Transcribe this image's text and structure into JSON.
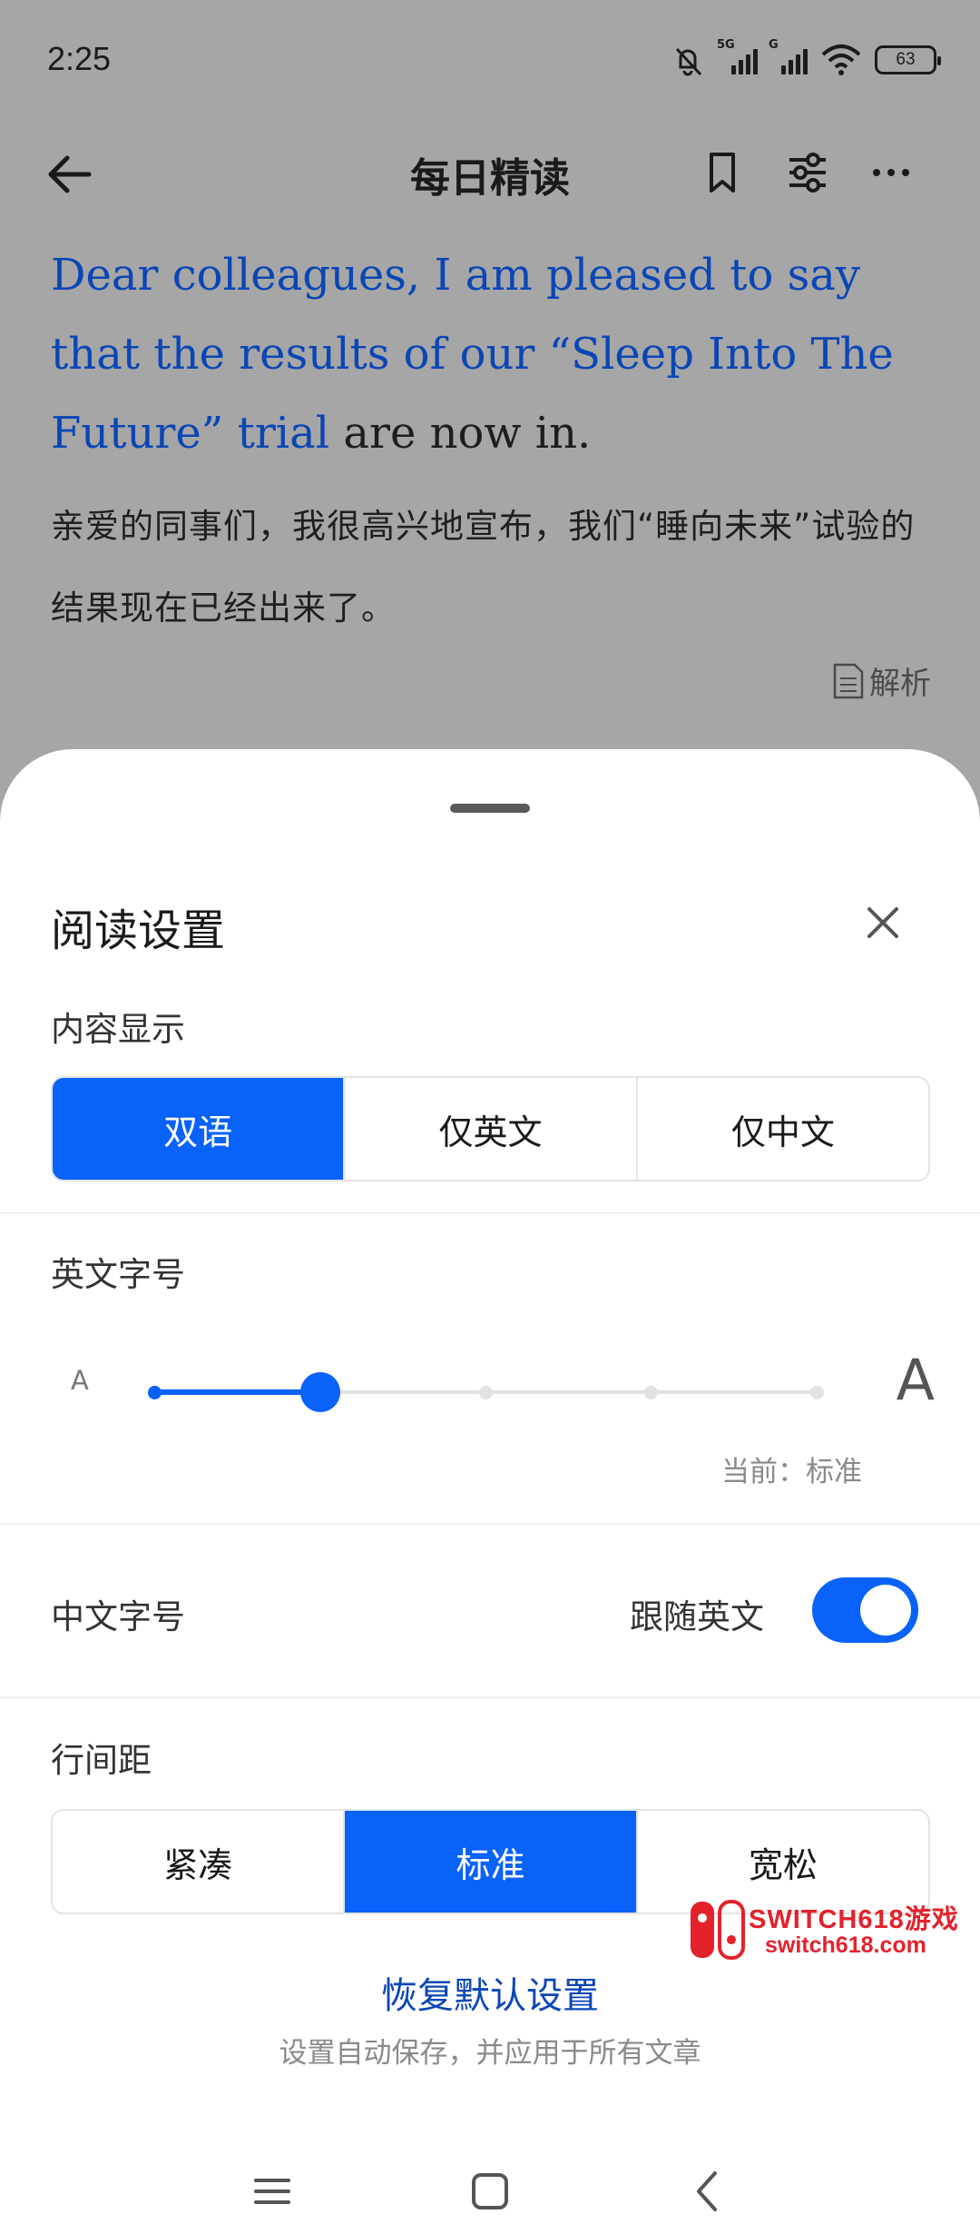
{
  "status_bar": {
    "time": "2:25",
    "signal_1_tag": "5G",
    "signal_2_tag": "G",
    "battery": "63",
    "icons": [
      "mute-bell-icon",
      "signal-icon",
      "wifi-icon",
      "battery-icon"
    ]
  },
  "header": {
    "title": "每日精读",
    "icons": [
      "back-arrow-icon",
      "bookmark-icon",
      "settings-sliders-icon",
      "more-dots-icon"
    ]
  },
  "article": {
    "en_highlight": "Dear colleagues, I am pleased to say that the results of our “Sleep Into The Future” trial",
    "en_rest": " are now in.",
    "zh": "亲爱的同事们，我很高兴地宣布，我们“睡向未来”试验的结果现在已经出来了。",
    "analysis_label": "解析"
  },
  "sheet": {
    "title": "阅读设置",
    "content_display": {
      "label": "内容显示",
      "options": [
        "双语",
        "仅英文",
        "仅中文"
      ],
      "selected": "双语"
    },
    "en_font_size": {
      "label": "英文字号",
      "small_label": "A",
      "big_label": "A",
      "steps": 5,
      "selected_index": 1,
      "current_text": "当前：标准"
    },
    "zh_font_size": {
      "label": "中文字号",
      "follow_label": "跟随英文",
      "follow_enabled": true
    },
    "line_spacing": {
      "label": "行间距",
      "options": [
        "紧凑",
        "标准",
        "宽松"
      ],
      "selected": "标准"
    },
    "restore_label": "恢复默认设置",
    "hint": "设置自动保存，并应用于所有文章"
  },
  "system_nav": {
    "icons": [
      "menu-icon",
      "home-icon",
      "back-icon"
    ]
  },
  "watermark": {
    "title": "SWITCH618游戏",
    "url": "switch618.com"
  },
  "colors": {
    "accent": "#0962f9",
    "link_blue": "#0a46b5",
    "overlay": "#a6a6a6"
  }
}
